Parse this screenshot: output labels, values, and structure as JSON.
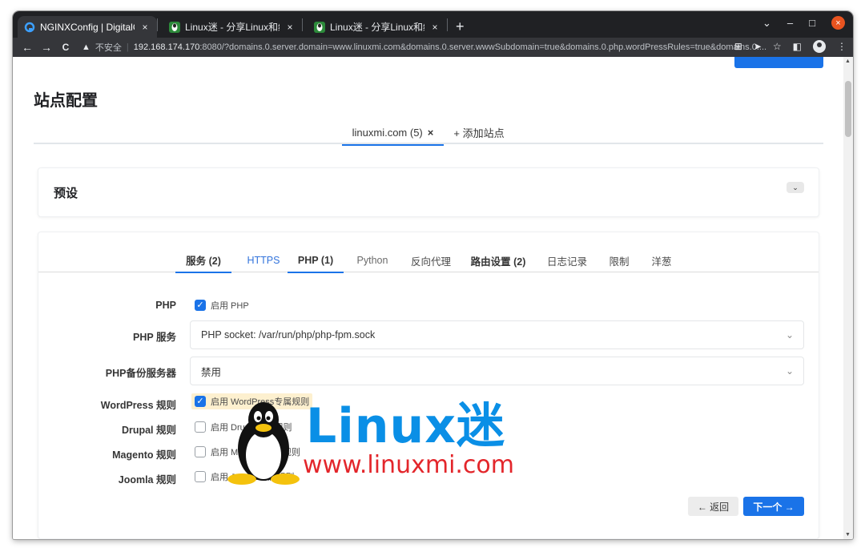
{
  "browser": {
    "tabs": [
      {
        "title": "NGINXConfig | DigitalOcean",
        "active": true
      },
      {
        "title": "Linux迷 - 分享Linux和编程",
        "active": false
      },
      {
        "title": "Linux迷 - 分享Linux和编程",
        "active": false
      }
    ],
    "new_tab": "+",
    "close_glyph": "×",
    "window_controls": {
      "minimize": "–",
      "maximize": "□",
      "close": "×",
      "menu": "⌄"
    },
    "nav": {
      "back": "←",
      "forward": "→",
      "reload": "C"
    },
    "security_label": "不安全",
    "url_host": "192.168.174.170",
    "url_rest": ":8080/?domains.0.server.domain=www.linuxmi.com&domains.0.server.wwwSubdomain=true&domains.0.php.wordPressRules=true&domains.0...."
  },
  "page": {
    "title": "站点配置",
    "site_tabs": [
      {
        "label": "linuxmi.com (5)",
        "close": "×"
      },
      {
        "label": "+ 添加站点"
      }
    ],
    "preset": {
      "title": "预设",
      "toggle": "⌄"
    },
    "sub_tabs": [
      "服务 (2)",
      "HTTPS",
      "PHP (1)",
      "Python",
      "反向代理",
      "路由设置 (2)",
      "日志记录",
      "限制",
      "洋葱"
    ],
    "form": {
      "php": {
        "label": "PHP",
        "option": "启用 PHP",
        "checked": true
      },
      "php_server": {
        "label": "PHP 服务",
        "value": "PHP socket: /var/run/php/php-fpm.sock"
      },
      "php_backup": {
        "label": "PHP备份服务器",
        "value": "禁用"
      },
      "wordpress": {
        "label": "WordPress 规则",
        "option": "启用 WordPress专属规则",
        "checked": true
      },
      "drupal": {
        "label": "Drupal 规则",
        "option": "启用 Drupal专属规则",
        "checked": false
      },
      "magento": {
        "label": "Magento 规则",
        "option": "启用 Magento专属规则",
        "checked": false
      },
      "joomla": {
        "label": "Joomla 规则",
        "option": "启用 Joomla专属规则",
        "checked": false
      }
    },
    "buttons": {
      "back": "← 返回",
      "next": "下一个 →"
    }
  },
  "watermark": {
    "brand": "Linux迷",
    "url": "www.linuxmi.com"
  },
  "colors": {
    "accent": "#1a73e8",
    "chrome_dark": "#202124",
    "highlight": "#fdf0cf"
  }
}
